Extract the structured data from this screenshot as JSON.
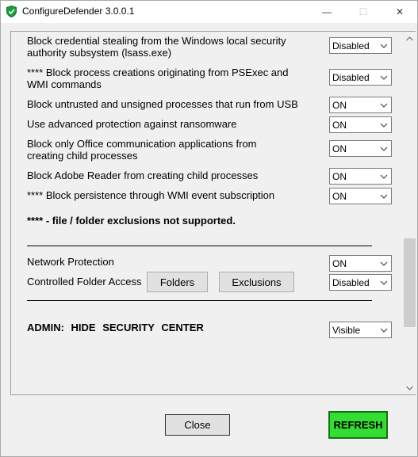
{
  "window": {
    "title": "ConfigureDefender 3.0.0.1",
    "minimize_glyph": "—",
    "maximize_glyph": "☐",
    "close_glyph": "✕"
  },
  "rules": [
    {
      "label_line1": "Block credential stealing from the Windows local security",
      "label_line2": "authority subsystem (lsass.exe)",
      "value": "Disabled"
    },
    {
      "label_line1": "**** Block process creations originating from PSExec and",
      "label_line2": "WMI commands",
      "value": "Disabled"
    },
    {
      "label_line1": "Block untrusted and unsigned processes that run from USB",
      "label_line2": "",
      "value": "ON"
    },
    {
      "label_line1": "Use advanced protection against ransomware",
      "label_line2": "",
      "value": "ON"
    },
    {
      "label_line1": "Block only Office communication applications from",
      "label_line2": "creating child processes",
      "value": "ON"
    },
    {
      "label_line1": "Block Adobe Reader from creating child processes",
      "label_line2": "",
      "value": "ON"
    },
    {
      "label_line1": "**** Block persistence through WMI event subscription",
      "label_line2": "",
      "value": "ON"
    }
  ],
  "note": "**** - file / folder exclusions not supported.",
  "network_protection": {
    "label": "Network Protection",
    "value": "ON"
  },
  "controlled_folder_access": {
    "label": "Controlled Folder Access",
    "folders_button": "Folders",
    "exclusions_button": "Exclusions",
    "value": "Disabled"
  },
  "admin": {
    "label": "ADMIN:  HIDE  SECURITY  CENTER",
    "value": "Visible"
  },
  "footer": {
    "close_button": "Close",
    "refresh_button": "REFRESH"
  },
  "colors": {
    "refresh_bg": "#33dd33",
    "shield_green": "#1e9e3e",
    "focus_blue": "#0078d7"
  }
}
